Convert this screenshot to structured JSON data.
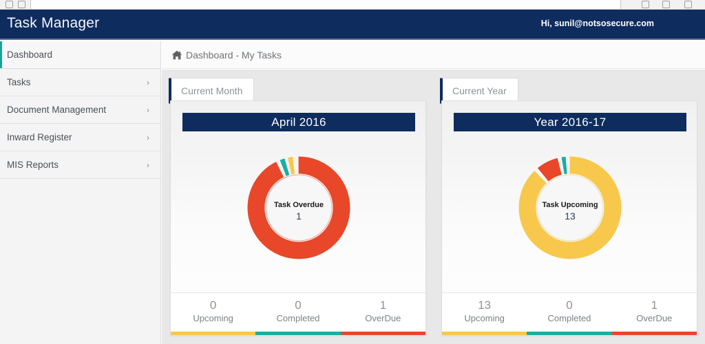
{
  "browser": {
    "tab_hint": "",
    "icons": [
      "back-icon",
      "forward-icon",
      "reload-icon",
      "bookmark-icon",
      "extension-icon",
      "profile-icon"
    ]
  },
  "topbar": {
    "app_title": "Task Manager",
    "greeting": "Hi, sunil@notsosecure.com"
  },
  "sidebar": {
    "items": [
      {
        "label": "Dashboard",
        "active": true,
        "has_chevron": false
      },
      {
        "label": "Tasks",
        "active": false,
        "has_chevron": true
      },
      {
        "label": "Document Management",
        "active": false,
        "has_chevron": true
      },
      {
        "label": "Inward Register",
        "active": false,
        "has_chevron": true
      },
      {
        "label": "MIS Reports",
        "active": false,
        "has_chevron": true
      }
    ],
    "chevron_glyph": "›"
  },
  "breadcrumb": {
    "icon": "home-icon",
    "text": "Dashboard - My Tasks"
  },
  "tabs": [
    {
      "id": "month",
      "label": "Current Month"
    },
    {
      "id": "year",
      "label": "Current Year"
    }
  ],
  "colors": {
    "navy": "#0e2c5e",
    "teal_accent": "#16a49a",
    "upcoming": "#f7c84b",
    "completed": "#1aada4",
    "overdue": "#e8472a",
    "page_bg": "#e8e8e8"
  },
  "cards": [
    {
      "id": "month",
      "title": "April 2016",
      "center_label": "Task Overdue",
      "center_value": "1",
      "stats": [
        {
          "value": "0",
          "label": "Upcoming",
          "color": "#f7c84b"
        },
        {
          "value": "0",
          "label": "Completed",
          "color": "#1aada4"
        },
        {
          "value": "1",
          "label": "OverDue",
          "color": "#e8472a"
        }
      ]
    },
    {
      "id": "year",
      "title": "Year 2016-17",
      "center_label": "Task Upcoming",
      "center_value": "13",
      "stats": [
        {
          "value": "13",
          "label": "Upcoming",
          "color": "#f7c84b"
        },
        {
          "value": "0",
          "label": "Completed",
          "color": "#1aada4"
        },
        {
          "value": "1",
          "label": "OverDue",
          "color": "#e8472a"
        }
      ]
    }
  ],
  "chart_data": [
    {
      "type": "pie",
      "variant": "donut",
      "title": "April 2016",
      "center_label": "Task Overdue",
      "center_value": 1,
      "categories": [
        "OverDue",
        "Completed",
        "Upcoming"
      ],
      "values": [
        1,
        0,
        0
      ],
      "display_fractions": [
        0.94,
        0.03,
        0.03
      ],
      "colors": [
        "#e8472a",
        "#1aada4",
        "#f7c84b"
      ],
      "legend": [
        "Upcoming",
        "Completed",
        "OverDue"
      ],
      "notes": "Dominant red OverDue arc; tiny teal and yellow slivers at bottom center"
    },
    {
      "type": "pie",
      "variant": "donut",
      "title": "Year 2016-17",
      "center_label": "Task Upcoming",
      "center_value": 13,
      "categories": [
        "Upcoming",
        "OverDue",
        "Completed"
      ],
      "values": [
        13,
        1,
        0
      ],
      "display_fractions": [
        0.89,
        0.08,
        0.03
      ],
      "colors": [
        "#f7c84b",
        "#e8472a",
        "#1aada4"
      ],
      "legend": [
        "Upcoming",
        "Completed",
        "OverDue"
      ],
      "notes": "Dominant yellow Upcoming arc; red OverDue wedge and thin teal sliver at bottom"
    }
  ]
}
